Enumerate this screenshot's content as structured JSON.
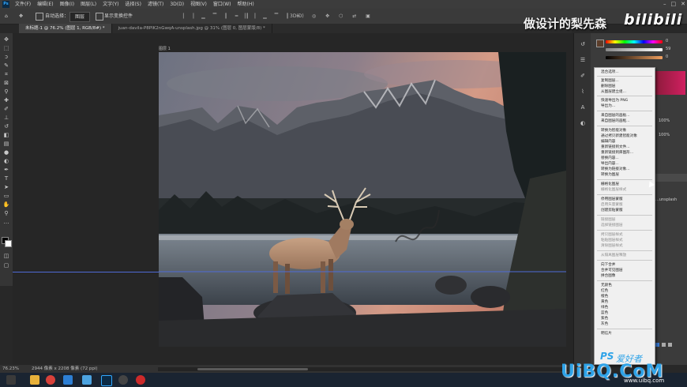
{
  "menubar": {
    "app_icon": "Ps",
    "items": [
      "文件(F)",
      "编辑(E)",
      "图像(I)",
      "图层(L)",
      "文字(Y)",
      "选择(S)",
      "滤镜(T)",
      "3D(D)",
      "视图(V)",
      "窗口(W)",
      "帮助(H)"
    ]
  },
  "optionsbar": {
    "auto_select_label": "自动选择：",
    "auto_select_value": "图层",
    "show_transform_label": "显示变换控件"
  },
  "tabs": [
    {
      "label": "未标题-1 @ 76.2% (图层 1, RGB/8#) *",
      "active": true
    },
    {
      "label": "juan-davila-P8PlK2nGwqA-unsplash.jpg @ 31% (图层 0, 图层蒙版/8) *",
      "active": false
    }
  ],
  "document": {
    "layer_label": "图层 1"
  },
  "statusbar": {
    "zoom": "76.23%",
    "doc_size": "2944 像素 x 2208 像素 (72 ppi)"
  },
  "right_panel": {
    "slider_values": [
      "0",
      "59",
      "0"
    ],
    "percent_values": [
      "100%",
      "100%"
    ],
    "side_text": "...unsplash"
  },
  "context_menu": {
    "items": [
      {
        "label": "混合选项...",
        "disabled": false
      },
      {
        "label": "复制图层...",
        "disabled": false
      },
      {
        "label": "删除图层",
        "disabled": false
      },
      {
        "label": "从图层建立组...",
        "disabled": false
      },
      {
        "label": "快速导出为 PNG",
        "disabled": false
      },
      {
        "label": "导出为...",
        "disabled": false
      },
      {
        "label": "来自图层的画板...",
        "disabled": false
      },
      {
        "label": "来自图层的画框...",
        "disabled": false
      },
      {
        "label": "转换为智能对象",
        "disabled": false
      },
      {
        "label": "通过拷贝新建智能对象",
        "disabled": false
      },
      {
        "label": "编辑内容",
        "disabled": false
      },
      {
        "label": "重新链接到文件...",
        "disabled": false
      },
      {
        "label": "重新链接到库图形...",
        "disabled": false
      },
      {
        "label": "替换内容...",
        "disabled": false
      },
      {
        "label": "导出内容...",
        "disabled": false
      },
      {
        "label": "转换为链接对象...",
        "disabled": false
      },
      {
        "label": "转换为图层",
        "disabled": false
      },
      {
        "label": "栅格化图层",
        "disabled": false
      },
      {
        "label": "栅格化图层样式",
        "disabled": true
      },
      {
        "label": "停用图层蒙版",
        "disabled": false
      },
      {
        "label": "启用矢量蒙版",
        "disabled": true
      },
      {
        "label": "创建剪贴蒙版",
        "disabled": false
      },
      {
        "label": "链接图层",
        "disabled": true
      },
      {
        "label": "选择链接图层",
        "disabled": true
      },
      {
        "label": "拷贝图层样式",
        "disabled": true
      },
      {
        "label": "粘贴图层样式",
        "disabled": true
      },
      {
        "label": "清除图层样式",
        "disabled": true
      },
      {
        "label": "从隔离图层释放",
        "disabled": true
      },
      {
        "label": "向下合并",
        "disabled": false
      },
      {
        "label": "合并可见图层",
        "disabled": false
      },
      {
        "label": "拼合图像",
        "disabled": false
      },
      {
        "label": "无颜色",
        "disabled": false
      },
      {
        "label": "红色",
        "disabled": false
      },
      {
        "label": "橙色",
        "disabled": false
      },
      {
        "label": "黄色",
        "disabled": false
      },
      {
        "label": "绿色",
        "disabled": false
      },
      {
        "label": "蓝色",
        "disabled": false
      },
      {
        "label": "紫色",
        "disabled": false
      },
      {
        "label": "灰色",
        "disabled": false
      },
      {
        "label": "明信片",
        "disabled": false
      }
    ]
  },
  "watermarks": {
    "top_text": "做设计的梨先森",
    "bili": "bilibili",
    "ps_brand": "PS",
    "ps_brand_text": "爱好者",
    "uibo": "UiBQ.CoM",
    "uibo_sub": "www.uibq.com"
  },
  "colors": {
    "accent": "#31a8ff",
    "photoshop_bg": "#282828",
    "menu_bg": "#f0f0f0"
  }
}
